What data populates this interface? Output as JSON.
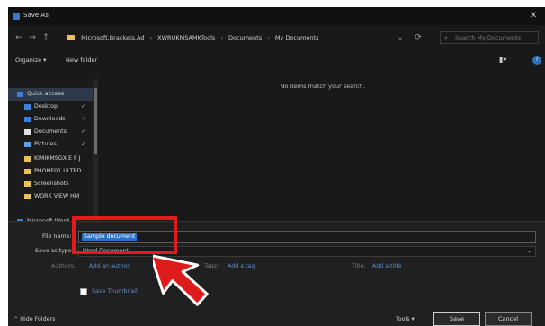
{
  "window": {
    "title": "Save As",
    "close_glyph": "✕"
  },
  "nav": {
    "back": "←",
    "forward": "→",
    "up": "↑",
    "breadcrumb": [
      "Microsoft.Brackets.Ad",
      "XWRUKMSAMKTools",
      "Documents",
      "My Documents"
    ],
    "refresh_glyph": "⟳",
    "search_placeholder": "Search My Documents"
  },
  "toolbar": {
    "organize": "Organize ▾",
    "new_folder": "New folder",
    "view_glyph": "▮▾",
    "help_glyph": "?"
  },
  "sidebar": {
    "items": [
      {
        "label": "Quick access",
        "icon": "star-icon",
        "color": "#3b7fd6"
      },
      {
        "label": "Desktop",
        "icon": "desktop-icon",
        "color": "#3b7fd6"
      },
      {
        "label": "Downloads",
        "icon": "download-icon",
        "color": "#3b7fd6"
      },
      {
        "label": "Documents",
        "icon": "document-icon",
        "color": "#e0e0e0"
      },
      {
        "label": "Pictures",
        "icon": "pictures-icon",
        "color": "#5aa0e6"
      },
      {
        "label": "KIMIKMSGX E F J",
        "icon": "folder-icon",
        "color": "#e8c158"
      },
      {
        "label": "PHONE01 ULTRD",
        "icon": "folder-icon",
        "color": "#e8c158"
      },
      {
        "label": "Screenshots",
        "icon": "folder-icon",
        "color": "#e8c158"
      },
      {
        "label": "WORK VIEW HM",
        "icon": "folder-icon",
        "color": "#e8c158"
      },
      {
        "label": "Microsoft Word",
        "icon": "word-icon",
        "color": "#3a78c8"
      }
    ],
    "pin_glyph": "✓"
  },
  "content": {
    "empty_message": "No items match your search."
  },
  "form": {
    "file_name_label": "File name:",
    "file_name_value": "Sample document",
    "save_type_label": "Save as type:",
    "save_type_value": "Word Document",
    "authors_label": "Authors:",
    "authors_value": "Add an author",
    "tags_label": "Tags:",
    "tags_value": "Add a tag",
    "title_label": "Title:",
    "title_value": "Add a title",
    "thumbnail_label": "Save Thumbnail",
    "dropdown_glyph": "⌄"
  },
  "footer": {
    "hide_folders": "⌃ Hide Folders",
    "tools": "Tools ▾",
    "save": "Save",
    "cancel": "Cancel"
  },
  "annotation": {
    "highlight_color": "#e01b1b"
  }
}
